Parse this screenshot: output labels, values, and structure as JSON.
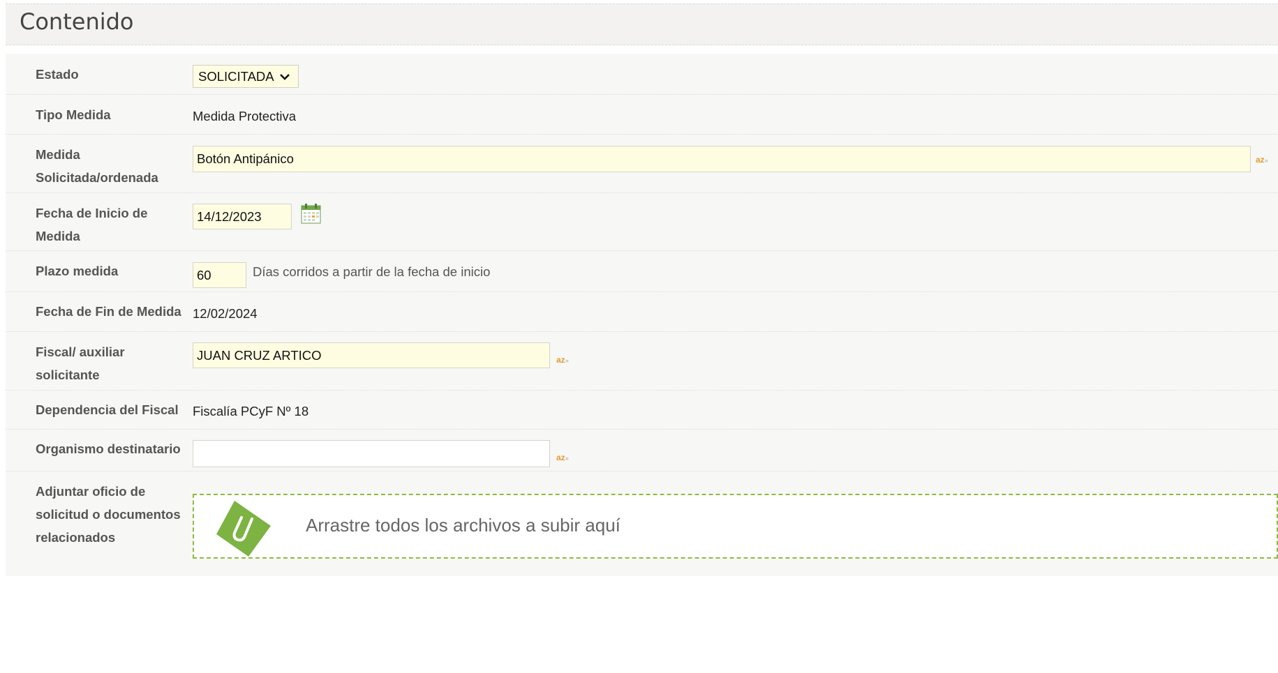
{
  "section": {
    "title": "Contenido"
  },
  "fields": {
    "estado": {
      "label": "Estado",
      "value": "SOLICITADA"
    },
    "tipo_medida": {
      "label": "Tipo Medida",
      "value": "Medida Protectiva"
    },
    "medida_solicitada": {
      "label_line1": "Medida",
      "label_line2": "Solicitada/ordenada",
      "value": "Botón Antipánico"
    },
    "fecha_inicio": {
      "label_line1": "Fecha de Inicio de",
      "label_line2": "Medida",
      "value": "14/12/2023"
    },
    "plazo": {
      "label": "Plazo medida",
      "value": "60",
      "hint": "Días corridos a partir de la fecha de inicio"
    },
    "fecha_fin": {
      "label": "Fecha de Fin de Medida",
      "value": "12/02/2024"
    },
    "fiscal": {
      "label_line1": "Fiscal/ auxiliar",
      "label_line2": "solicitante",
      "value": "JUAN CRUZ ARTICO"
    },
    "dependencia": {
      "label": "Dependencia del Fiscal",
      "value": "Fiscalía PCyF Nº 18"
    },
    "organismo": {
      "label": "Organismo destinatario",
      "value": ""
    },
    "adjuntar": {
      "label_line1": "Adjuntar oficio de",
      "label_line2": "solicitud o documentos",
      "label_line3": "relacionados",
      "dropzone_text": "Arrastre todos los archivos a subir aquí"
    }
  },
  "autocomplete_marker": "az",
  "icons": {
    "calendar": "calendar-icon",
    "select_arrow": "chevron-down-icon",
    "autocomplete": "autocomplete-icon",
    "attachment": "paperclip-icon"
  },
  "colors": {
    "input_bg": "#fefde1",
    "row_bg": "#f7f7f6",
    "autocomplete_accent": "#e49b2f",
    "dropzone_border": "#8bbc3c"
  }
}
